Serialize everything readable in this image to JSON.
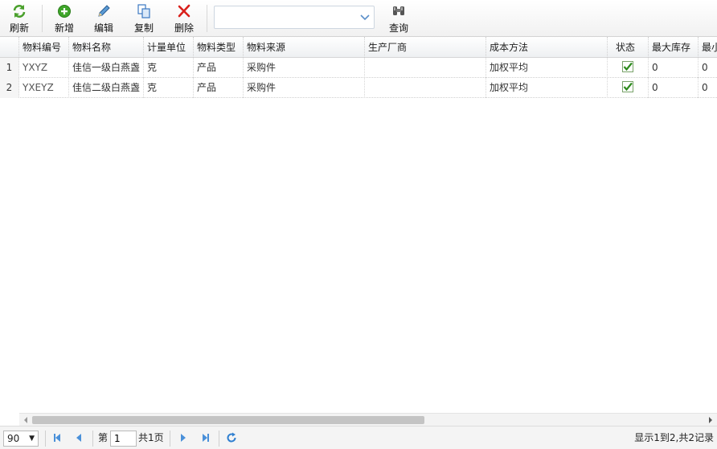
{
  "toolbar": {
    "refresh_label": "刷新",
    "add_label": "新增",
    "edit_label": "编辑",
    "copy_label": "复制",
    "delete_label": "删除",
    "search_label": "查询",
    "combo_value": ""
  },
  "grid": {
    "columns": [
      "物料编号",
      "物料名称",
      "计量单位",
      "物料类型",
      "物料来源",
      "生产厂商",
      "成本方法",
      "状态",
      "最大库存",
      "最小"
    ],
    "rows": [
      {
        "num": "1",
        "code": "YXYZ",
        "name": "佳信一级白燕盏",
        "unit": "克",
        "type": "产品",
        "source": "采购件",
        "maker": "",
        "cost": "加权平均",
        "status": true,
        "max": "0",
        "min": "0"
      },
      {
        "num": "2",
        "code": "YXEYZ",
        "name": "佳信二级白燕盏",
        "unit": "克",
        "type": "产品",
        "source": "采购件",
        "maker": "",
        "cost": "加权平均",
        "status": true,
        "max": "0",
        "min": "0"
      }
    ]
  },
  "pager": {
    "page_size": "90",
    "page_prefix": "第",
    "page_value": "1",
    "page_total": "共1页",
    "summary": "显示1到2,共2记录"
  },
  "colors": {
    "check_green": "#2e8b1e",
    "nav_blue": "#4a90d9"
  }
}
